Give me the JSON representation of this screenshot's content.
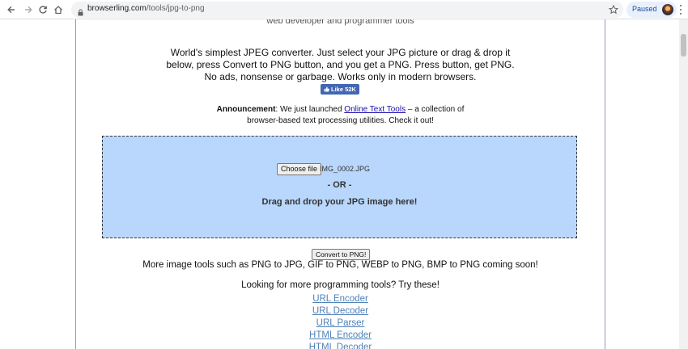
{
  "browser": {
    "url_host": "browserling.com",
    "url_path": "/tools/jpg-to-png",
    "profile_status": "Paused"
  },
  "page": {
    "tagline": "web developer and programmer tools",
    "intro_lines": [
      "World's simplest JPEG converter. Just select your JPG picture or drag & drop it",
      "below, press Convert to PNG button, and you get a PNG. Press button, get PNG.",
      "No ads, nonsense or garbage. Works only in modern browsers."
    ],
    "like_label": "Like 52K",
    "announcement": {
      "label": "Announcement",
      "before_link": ": We just launched ",
      "link_text": "Online Text Tools",
      "after_link": " – a collection of",
      "line2": "browser-based text processing utilities. Check it out!"
    },
    "upload": {
      "choose_label": "Choose file",
      "filename": "IMG_0002.JPG",
      "or_text": "- OR -",
      "drag_text": "Drag and drop your JPG image here!"
    },
    "convert_label": "Convert to PNG!",
    "more_tools_text": "More image tools such as PNG to JPG, GIF to PNG, WEBP to PNG, BMP to PNG coming soon!",
    "looking_text": "Looking for more programming tools? Try these!",
    "tool_links": [
      "URL Encoder",
      "URL Decoder",
      "URL Parser",
      "HTML Encoder",
      "HTML Decoder"
    ]
  }
}
